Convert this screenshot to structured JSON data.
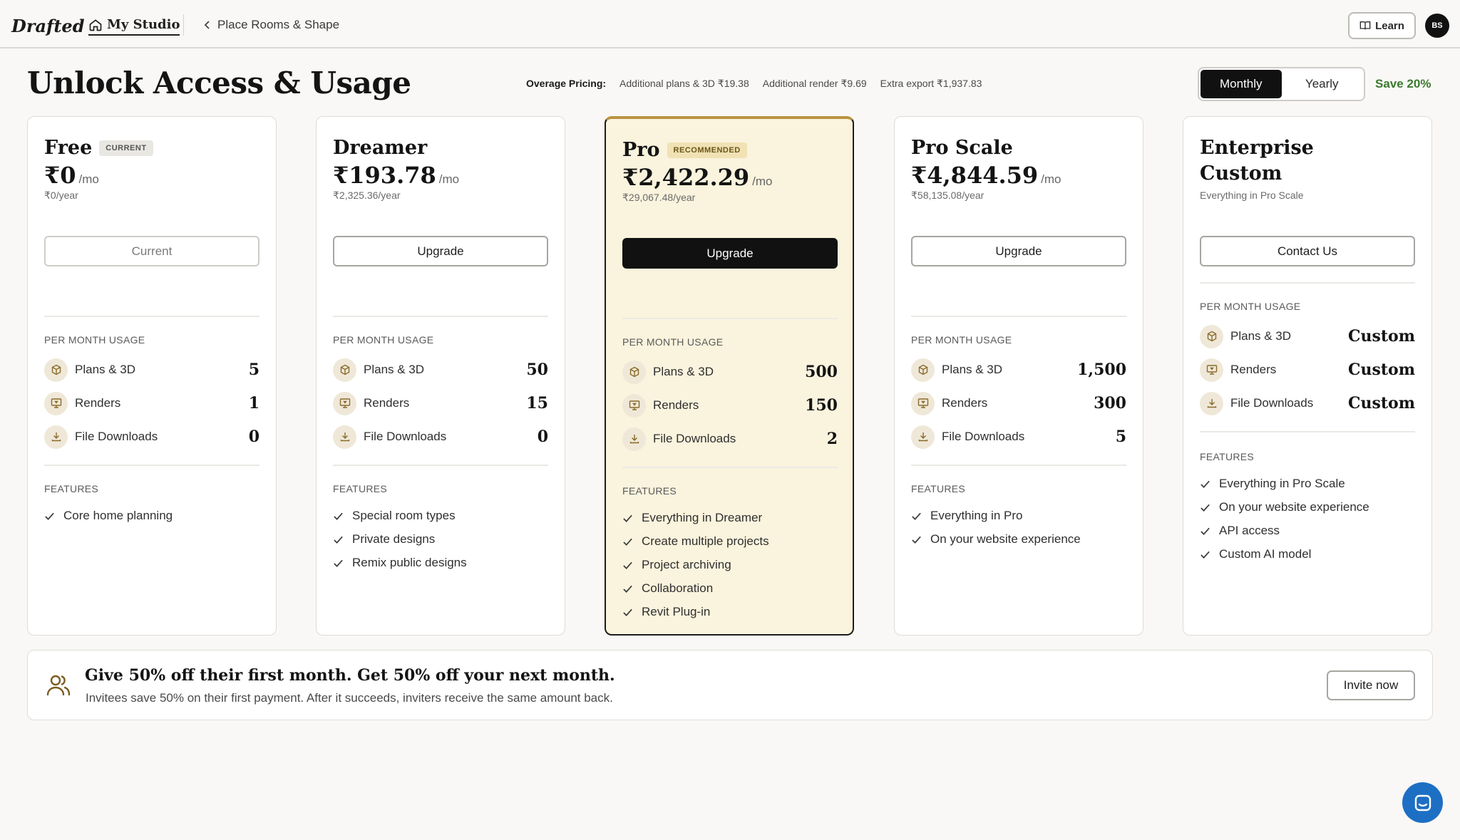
{
  "topbar": {
    "logo": "Drafted",
    "studio_label": "My Studio",
    "breadcrumb": "Place Rooms & Shape",
    "learn_label": "Learn",
    "avatar_initials": "BS"
  },
  "header": {
    "title": "Unlock Access & Usage",
    "overage_label": "Overage Pricing:",
    "overage_items": [
      "Additional plans & 3D ₹19.38",
      "Additional render ₹9.69",
      "Extra export ₹1,937.83"
    ],
    "billing_options": [
      "Monthly",
      "Yearly"
    ],
    "billing_selected": "Monthly",
    "save_text": "Save 20%"
  },
  "labels": {
    "usage_section": "PER MONTH USAGE",
    "features_section": "FEATURES",
    "per_month": "/mo",
    "usage_names": [
      "Plans & 3D",
      "Renders",
      "File Downloads"
    ]
  },
  "plans": [
    {
      "name": "Free",
      "badge": "CURRENT",
      "price": "₹0",
      "yearly": "₹0/year",
      "button": "Current",
      "usage": [
        "5",
        "1",
        "0"
      ],
      "features": [
        "Core home planning"
      ]
    },
    {
      "name": "Dreamer",
      "badge": "",
      "price": "₹193.78",
      "yearly": "₹2,325.36/year",
      "button": "Upgrade",
      "usage": [
        "50",
        "15",
        "0"
      ],
      "features": [
        "Special room types",
        "Private designs",
        "Remix public designs"
      ]
    },
    {
      "name": "Pro",
      "badge": "RECOMMENDED",
      "price": "₹2,422.29",
      "yearly": "₹29,067.48/year",
      "button": "Upgrade",
      "usage": [
        "500",
        "150",
        "2"
      ],
      "features": [
        "Everything in Dreamer",
        "Create multiple projects",
        "Project archiving",
        "Collaboration",
        "Revit Plug-in"
      ]
    },
    {
      "name": "Pro Scale",
      "badge": "",
      "price": "₹4,844.59",
      "yearly": "₹58,135.08/year",
      "button": "Upgrade",
      "usage": [
        "1,500",
        "300",
        "5"
      ],
      "features": [
        "Everything in Pro",
        "On your website experience"
      ]
    },
    {
      "name": "Enterprise Custom",
      "badge": "",
      "price": "",
      "yearly": "Everything in Pro Scale",
      "button": "Contact Us",
      "usage": [
        "Custom",
        "Custom",
        "Custom"
      ],
      "features": [
        "Everything in Pro Scale",
        "On your website experience",
        "API access",
        "Custom AI model"
      ]
    }
  ],
  "referral": {
    "title": "Give 50% off their first month. Get 50% off your next month.",
    "subtitle": "Invitees save 50% on their first payment. After it succeeds, inviters receive the same amount back.",
    "button": "Invite now"
  },
  "colors": {
    "accent_gold": "#b99442",
    "pro_bg": "#faf3dd",
    "save_green": "#3c7a2e",
    "chat_blue": "#1d6fc4"
  }
}
